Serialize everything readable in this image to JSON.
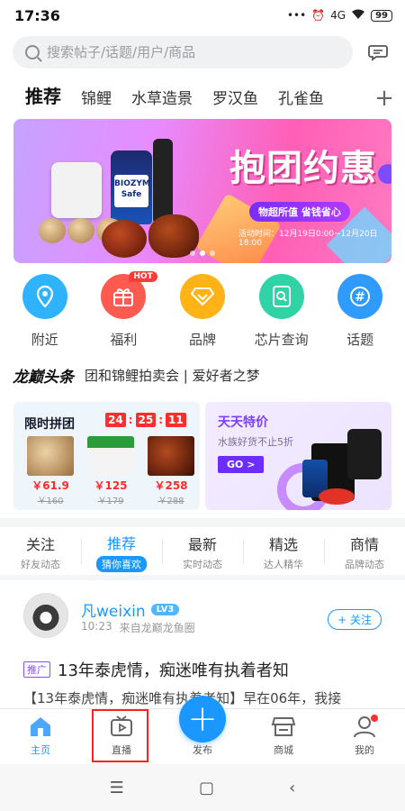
{
  "status_bar": {
    "time": "17:36",
    "signal": "4G",
    "battery": "99"
  },
  "search": {
    "placeholder": "搜索帖子/话题/用户/商品"
  },
  "tabs": [
    {
      "label": "推荐"
    },
    {
      "label": "锦鲤"
    },
    {
      "label": "水草造景"
    },
    {
      "label": "罗汉鱼"
    },
    {
      "label": "孔雀鱼"
    }
  ],
  "banner": {
    "title": "抱团约惠",
    "slogan": "物超所值 省钱省心",
    "date": "活动时间：12月19日0:00~12月20日18:00",
    "product_label": "BIOZYM Safe"
  },
  "quick_entries": [
    {
      "label": "附近",
      "icon": "location-icon",
      "color": "#2fb3ff"
    },
    {
      "label": "福利",
      "icon": "gift-icon",
      "color": "#ff5a4f",
      "badge": "HOT"
    },
    {
      "label": "品牌",
      "icon": "diamond-icon",
      "color": "#ffb319"
    },
    {
      "label": "芯片查询",
      "icon": "chip-search-icon",
      "color": "#2fd3a5"
    },
    {
      "label": "话题",
      "icon": "hashtag-icon",
      "color": "#2f9bff"
    }
  ],
  "headline": {
    "logo": "龙巅头条",
    "text": "团和锦鲤拍卖会 | 爱好者之梦"
  },
  "group_buy": {
    "title": "限时拼团",
    "countdown": [
      "24",
      "25",
      "11"
    ],
    "products": [
      {
        "price": "￥61.9",
        "original": "￥160"
      },
      {
        "price": "￥125",
        "original": "￥179"
      },
      {
        "price": "￥258",
        "original": "￥288"
      }
    ]
  },
  "daily_deal": {
    "title": "天天特价",
    "subtitle": "水族好货不止5折",
    "button": "GO >"
  },
  "feed_tabs": [
    {
      "name": "关注",
      "sub": "好友动态"
    },
    {
      "name": "推荐",
      "sub": "猜你喜欢",
      "active": true
    },
    {
      "name": "最新",
      "sub": "实时动态"
    },
    {
      "name": "精选",
      "sub": "达人精华"
    },
    {
      "name": "商情",
      "sub": "品牌动态"
    }
  ],
  "post": {
    "username": "凡weixin",
    "level": "LV3",
    "time": "10:23",
    "source": "来自龙巅龙鱼圈",
    "follow": "+ 关注",
    "tag": "推广",
    "title": "13年泰虎情，痴迷唯有执着者知",
    "excerpt": "【13年泰虎情，痴迷唯有执着者知】早在06年，我接"
  },
  "bottom_nav": [
    {
      "label": "主页",
      "icon": "home-icon",
      "active": true
    },
    {
      "label": "直播",
      "icon": "live-tv-icon"
    },
    {
      "label": "发布",
      "icon": "plus-icon"
    },
    {
      "label": "商城",
      "icon": "store-icon"
    },
    {
      "label": "我的",
      "icon": "profile-icon"
    }
  ],
  "colors": {
    "accent": "#1a98ff",
    "price": "#ff2b2b",
    "highlight": "#ff2020"
  }
}
